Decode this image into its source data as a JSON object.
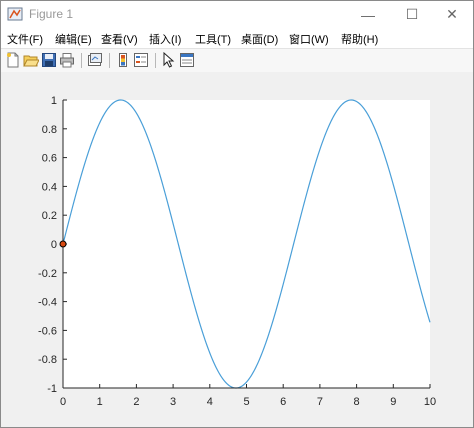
{
  "window": {
    "title": "Figure 1",
    "minimize": "—",
    "maximize": "☐",
    "close": "✕"
  },
  "menu": [
    "文件(F)",
    "编辑(E)",
    "查看(V)",
    "插入(I)",
    "工具(T)",
    "桌面(D)",
    "窗口(W)",
    "帮助(H)"
  ],
  "toolbar": {
    "icons": [
      "new-figure-icon",
      "open-file-icon",
      "save-icon",
      "print-icon",
      "link-plot-icon",
      "insert-colorbar-icon",
      "insert-legend-icon",
      "edit-plot-icon",
      "property-editor-icon"
    ]
  },
  "chart_data": {
    "type": "line",
    "title": "",
    "xlabel": "",
    "ylabel": "",
    "xlim": [
      0,
      10
    ],
    "ylim": [
      -1,
      1
    ],
    "xticks": [
      "0",
      "1",
      "2",
      "3",
      "4",
      "5",
      "6",
      "7",
      "8",
      "9",
      "10"
    ],
    "yticks": [
      "1",
      "0.8",
      "0.6",
      "0.4",
      "0.2",
      "0",
      "-0.2",
      "-0.4",
      "-0.6",
      "-0.8",
      "-1"
    ],
    "series": [
      {
        "function": "sin(x)",
        "x_start": 0,
        "x_end": 10,
        "color": "#4a9fd8"
      }
    ],
    "marker": {
      "x": 0,
      "y": 0,
      "color": "#d94a12"
    },
    "grid": false,
    "colors": {
      "line": "#4a9fd8",
      "axes": "#262626",
      "plot_bg": "#ffffff",
      "figure_bg": "#f0f0f0"
    }
  }
}
